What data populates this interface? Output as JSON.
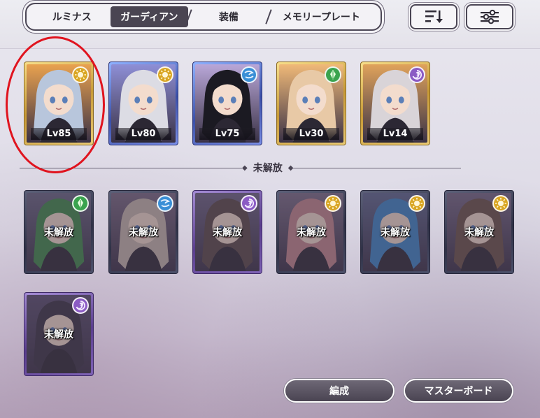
{
  "tabs": [
    {
      "label": "ルミナス",
      "selected": false
    },
    {
      "label": "ガーディアン",
      "selected": true
    },
    {
      "label": "装備",
      "selected": false
    },
    {
      "label": "メモリープレート",
      "selected": false
    }
  ],
  "toolbar": {
    "sort_icon": "sort-descending-icon",
    "filter_icon": "filter-sliders-icon"
  },
  "unlocked_cards": [
    {
      "level": "Lv85",
      "element_icon": "sun-icon",
      "element_color": "#d9a623",
      "rarity": "gold",
      "hair": "#b8c6dc",
      "bg": "#e9a24f"
    },
    {
      "level": "Lv80",
      "element_icon": "sun-icon",
      "element_color": "#d9a623",
      "rarity": "blue",
      "hair": "#dcdce4",
      "bg": "#8e8fd6"
    },
    {
      "level": "Lv75",
      "element_icon": "wind-icon",
      "element_color": "#3a8fd6",
      "rarity": "blue",
      "hair": "#1b1a22",
      "bg": "#b9a7d8"
    },
    {
      "level": "Lv30",
      "element_icon": "nature-icon",
      "element_color": "#3aa34e",
      "rarity": "gold",
      "hair": "#e8c9a6",
      "bg": "#f0b978"
    },
    {
      "level": "Lv14",
      "element_icon": "dark-spiral-icon",
      "element_color": "#8b5bc4",
      "rarity": "gold",
      "hair": "#d9d4d8",
      "bg": "#e0a35b"
    }
  ],
  "divider_label": "未解放",
  "locked_cards": [
    {
      "label": "未解放",
      "element_icon": "nature-icon",
      "element_color": "#3aa34e",
      "hair": "#3f8a4a",
      "bg": "#6a6884"
    },
    {
      "label": "未解放",
      "element_icon": "wind-icon",
      "element_color": "#3a8fd6",
      "hair": "#c7b8ad",
      "bg": "#7b6c84"
    },
    {
      "label": "未解放",
      "element_icon": "dark-spiral-icon",
      "element_color": "#8b5bc4",
      "hair": "#5a4a48",
      "bg": "#6f6686"
    },
    {
      "label": "未解放",
      "element_icon": "sun-icon",
      "element_color": "#d9a623",
      "hair": "#c4878c",
      "bg": "#7c6f88"
    },
    {
      "label": "未解放",
      "element_icon": "sun-icon",
      "element_color": "#d9a623",
      "hair": "#3c86c6",
      "bg": "#5f6a90"
    },
    {
      "label": "未解放",
      "element_icon": "sun-icon",
      "element_color": "#d9a623",
      "hair": "#6a5248",
      "bg": "#766a86"
    },
    {
      "label": "未解放",
      "element_icon": "dark-spiral-icon",
      "element_color": "#8b5bc4",
      "hair": "#3a3444",
      "bg": "#5a5070"
    }
  ],
  "buttons": {
    "formation": "編成",
    "master_board": "マスターボード"
  }
}
